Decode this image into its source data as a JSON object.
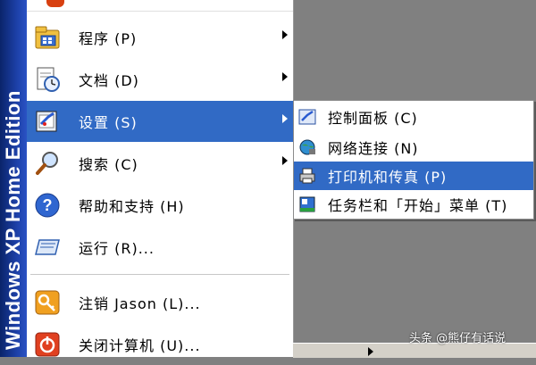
{
  "banner": {
    "text_a": "Windows XP",
    "text_b": " Home Edition"
  },
  "menu": {
    "items": [
      {
        "label": "程序 (P)",
        "icon": "programs-icon",
        "has_submenu": true
      },
      {
        "label": "文档 (D)",
        "icon": "documents-icon",
        "has_submenu": true
      },
      {
        "label": "设置 (S)",
        "icon": "settings-icon",
        "has_submenu": true
      },
      {
        "label": "搜索 (C)",
        "icon": "search-icon",
        "has_submenu": true
      },
      {
        "label": "帮助和支持 (H)",
        "icon": "help-icon",
        "has_submenu": false
      },
      {
        "label": "运行 (R)...",
        "icon": "run-icon",
        "has_submenu": false
      },
      {
        "label": "注销 Jason (L)...",
        "icon": "logoff-icon",
        "has_submenu": false
      },
      {
        "label": "关闭计算机 (U)...",
        "icon": "shutdown-icon",
        "has_submenu": false
      }
    ]
  },
  "submenu": {
    "items": [
      {
        "label": "控制面板 (C)",
        "icon": "control-panel-icon"
      },
      {
        "label": "网络连接 (N)",
        "icon": "network-icon"
      },
      {
        "label": "打印机和传真 (P)",
        "icon": "printer-icon"
      },
      {
        "label": "任务栏和「开始」菜单 (T)",
        "icon": "taskbar-icon"
      }
    ]
  },
  "watermark": "头条 @熊仔有话说",
  "colors": {
    "highlight": "#316ac5",
    "banner": "#1c3fa6",
    "desktop": "#808080"
  }
}
